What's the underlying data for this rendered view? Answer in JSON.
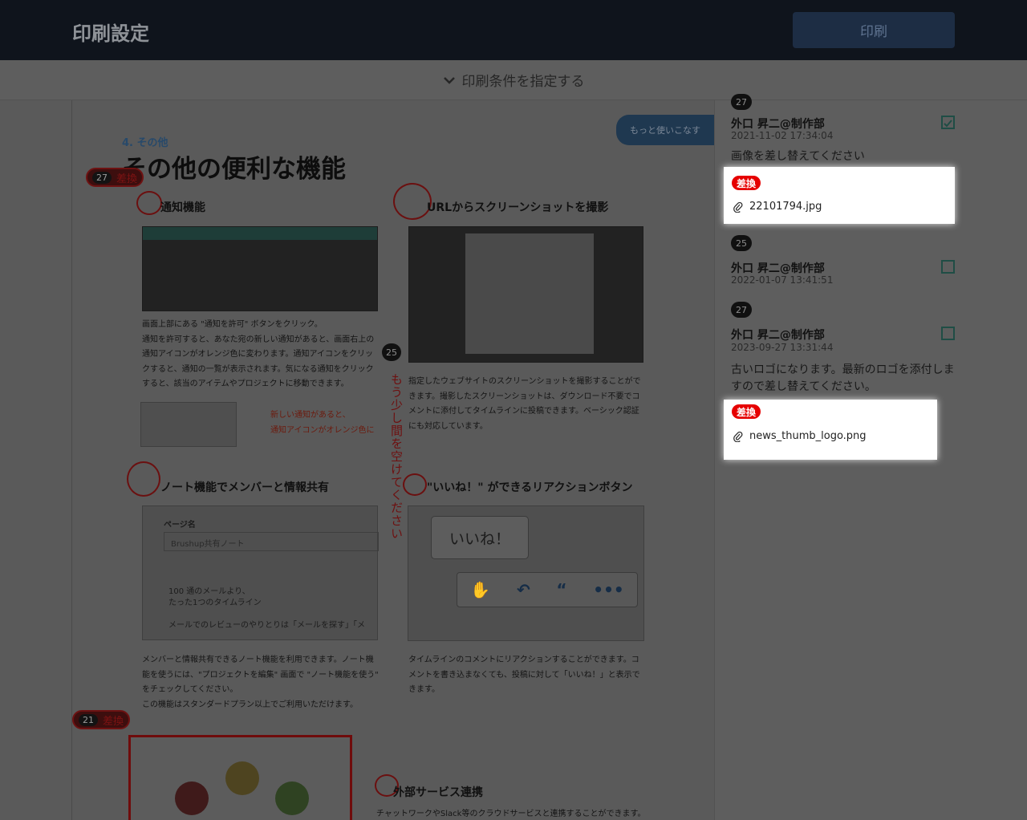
{
  "header": {
    "title": "印刷設定",
    "print_label": "印刷"
  },
  "condition_bar": {
    "label": "印刷条件を指定する"
  },
  "doc": {
    "subtitle": "4. その他",
    "heading": "その他の便利な機能",
    "tab_label": "もっと使いこなす",
    "pins": [
      {
        "num": "27",
        "label": "差換"
      },
      {
        "num": "21",
        "label": "差換"
      }
    ],
    "vertical_note": "もう少し間を空けてください",
    "vertical_badge": "25",
    "sections": [
      {
        "title": "通知機能",
        "text": "画面上部にある \"通知を許可\" ボタンをクリック。\n通知を許可すると、あなた宛の新しい通知があると、画面右上の通知アイコンがオレンジ色に変わります。通知アイコンをクリックすると、通知の一覧が表示されます。気になる通知をクリックすると、該当のアイテムやプロジェクトに移動できます。",
        "callout": "新しい通知があると、\n通知アイコンがオレンジ色に"
      },
      {
        "title": "URLからスクリーンショットを撮影",
        "text": "指定したウェブサイトのスクリーンショットを撮影することができます。撮影したスクリーンショットは、ダウンロード不要でコメントに添付してタイムラインに投稿できます。ベーシック認証にも対応しています。"
      },
      {
        "title": "ノート機能でメンバーと情報共有",
        "text": "メンバーと情報共有できるノート機能を利用できます。ノート機能を使うには、\"プロジェクトを編集\" 画面で \"ノート機能を使う\" をチェックしてください。\nこの機能はスタンダードプラン以上でご利用いただけます。",
        "note_page": "ページ名",
        "note_name": "Brushup共有ノート",
        "note_body": "100 通のメールより、\nたった1つのタイムライン\n\nメールでのレビューのやりとりは「メールを探す」「メ"
      },
      {
        "title": "\"いいね！\" ができるリアクションボタン",
        "text": "タイムラインのコメントにリアクションすることができます。コメントを書き込まなくても、投稿に対して「いいね！」と表示できます。",
        "bubble": "いいね！"
      },
      {
        "title": "外部サービス連携",
        "text": "チャットワークやSlack等のクラウドサービスと連携することができます。"
      }
    ]
  },
  "comments": [
    {
      "badge": "27",
      "user": "外口 昇二@制作部",
      "date": "2021-11-02 17:34:04",
      "text": "画像を差し替えてください",
      "tag": "差換",
      "file": "22101794.jpg",
      "checked": true
    },
    {
      "badge": "25",
      "user": "外口 昇二@制作部",
      "date": "2022-01-07 13:41:51",
      "checked": false
    },
    {
      "badge": "27",
      "user": "外口 昇二@制作部",
      "date": "2023-09-27 13:31:44",
      "text": "古いロゴになります。最新のロゴを添付しますので差し替えてください。",
      "tag": "差換",
      "file": "news_thumb_logo.png",
      "checked": false
    }
  ],
  "colors": {
    "highlight": "#ffffff",
    "tag": "#e60000",
    "header": "#0f141c"
  }
}
